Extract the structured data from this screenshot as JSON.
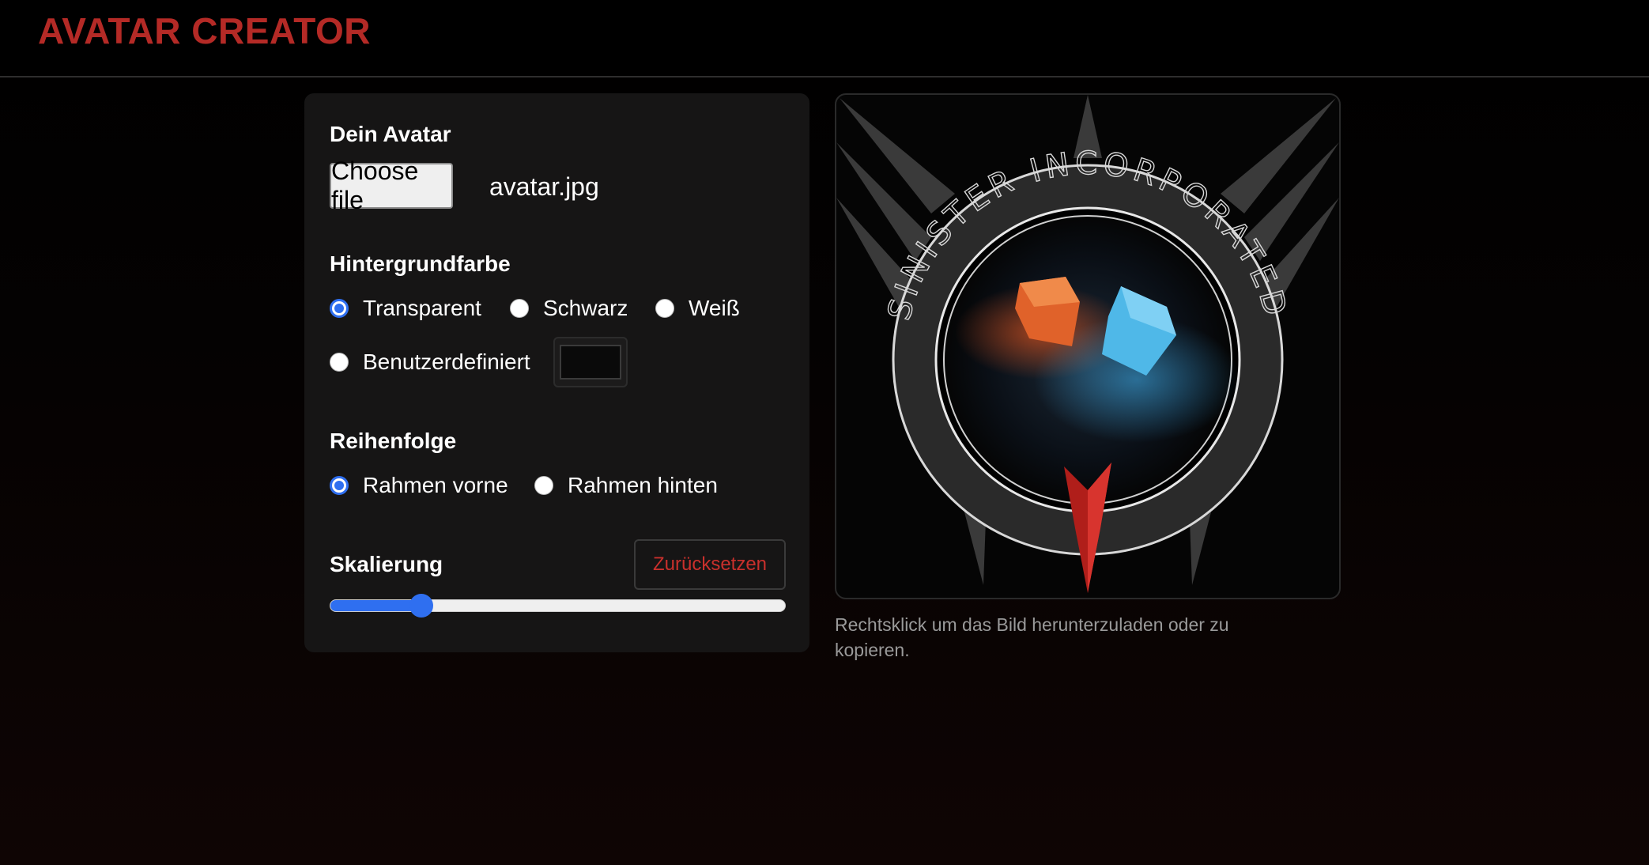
{
  "header": {
    "title": "AVATAR CREATOR"
  },
  "avatar_section": {
    "label": "Dein Avatar",
    "file_button": "Choose file",
    "file_name": "avatar.jpg"
  },
  "background_section": {
    "label": "Hintergrundfarbe",
    "options": [
      {
        "label": "Transparent",
        "checked": true
      },
      {
        "label": "Schwarz",
        "checked": false
      },
      {
        "label": "Weiß",
        "checked": false
      },
      {
        "label": "Benutzerdefiniert",
        "checked": false
      }
    ],
    "custom_color": "#0a0a0a"
  },
  "order_section": {
    "label": "Reihenfolge",
    "options": [
      {
        "label": "Rahmen vorne",
        "checked": true
      },
      {
        "label": "Rahmen hinten",
        "checked": false
      }
    ]
  },
  "scale_section": {
    "label": "Skalierung",
    "reset_button": "Zurücksetzen",
    "slider_value": 0.2
  },
  "preview": {
    "ring_text": "SINISTER INCORPORATED",
    "hint": "Rechtsklick um das Bild herunterzuladen oder zu kopieren."
  },
  "colors": {
    "brand_red": "#b42a26",
    "accent_blue": "#2f6ff0",
    "panel_bg": "#161515"
  }
}
